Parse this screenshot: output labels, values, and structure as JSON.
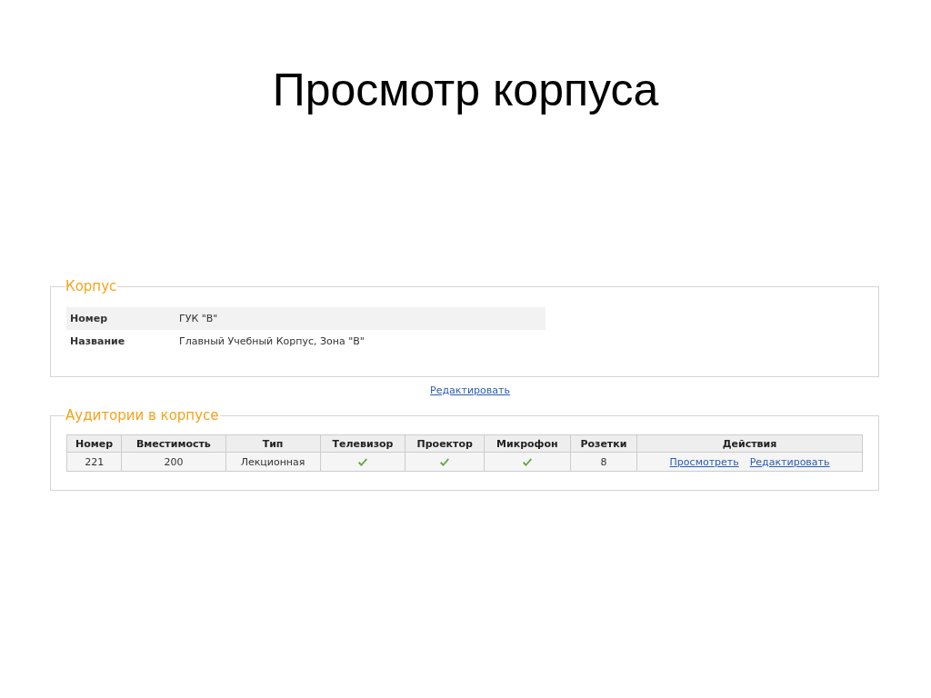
{
  "slide_title": "Просмотр корпуса",
  "building": {
    "legend": "Корпус",
    "fields": [
      {
        "label": "Номер",
        "value": "ГУК \"В\""
      },
      {
        "label": "Название",
        "value": "Главный Учебный Корпус, Зона \"В\""
      }
    ],
    "edit_link": "Редактировать"
  },
  "rooms": {
    "legend": "Аудитории в корпусе",
    "columns": [
      "Номер",
      "Вместимость",
      "Тип",
      "Телевизор",
      "Проектор",
      "Микрофон",
      "Розетки",
      "Действия"
    ],
    "rows": [
      {
        "number": "221",
        "capacity": "200",
        "type": "Лекционная",
        "tv": true,
        "projector": true,
        "microphone": true,
        "sockets": "8",
        "actions": [
          "Просмотреть",
          "Редактировать"
        ]
      }
    ]
  }
}
